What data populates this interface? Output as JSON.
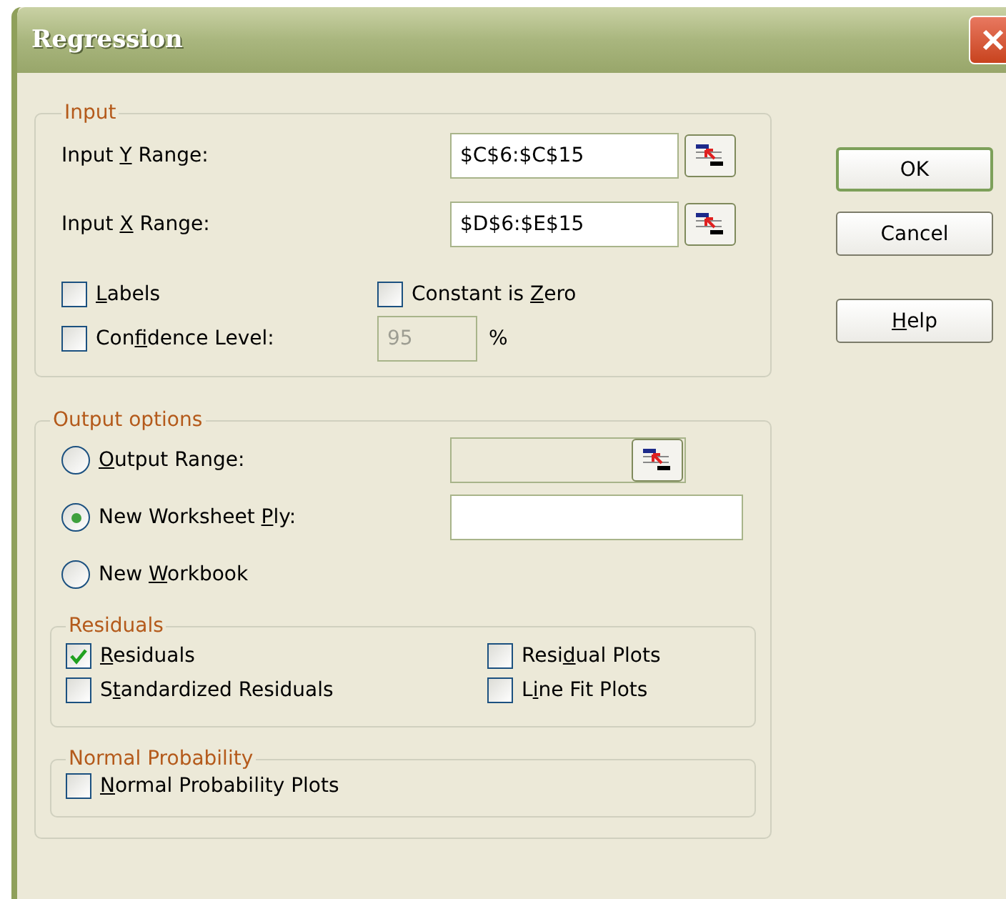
{
  "window": {
    "title": "Regression"
  },
  "input": {
    "title": "Input",
    "ranges": [
      {
        "label": {
          "pre": "Input ",
          "key": "Y",
          "post": " Range:"
        },
        "value": "$C$6:$C$15",
        "disabled": false
      },
      {
        "label": {
          "pre": "Input ",
          "key": "X",
          "post": " Range:"
        },
        "value": "$D$6:$E$15",
        "disabled": false
      }
    ],
    "labels": {
      "label": {
        "key": "L",
        "post": "abels"
      },
      "checked": false
    },
    "constant_zero": {
      "label": {
        "pre": "Constant is ",
        "key": "Z",
        "post": "ero"
      },
      "checked": false
    },
    "confidence": {
      "label": {
        "pre": "Con",
        "key": "f",
        "post": "idence Level:"
      },
      "checked": false,
      "value": "95",
      "disabled": true,
      "unit": "%"
    }
  },
  "output": {
    "title": "Output options",
    "destinations": [
      {
        "label": {
          "key": "O",
          "post": "utput Range:"
        },
        "selected": false,
        "field": {
          "disabled": true,
          "picker": true
        }
      },
      {
        "label": {
          "pre": "New Worksheet ",
          "key": "P",
          "post": "ly:"
        },
        "selected": true,
        "field": {
          "disabled": false,
          "picker": false
        }
      },
      {
        "label": {
          "pre": "New ",
          "key": "W",
          "post": "orkbook"
        },
        "selected": false
      }
    ],
    "residuals": {
      "title": "Residuals",
      "options": [
        {
          "label": {
            "key": "R",
            "post": "esiduals"
          },
          "checked": true
        },
        {
          "label": {
            "pre": "Resi",
            "key": "d",
            "post": "ual Plots"
          },
          "checked": false
        },
        {
          "label": {
            "pre": "S",
            "key": "t",
            "post": "andardized Residuals"
          },
          "checked": false
        },
        {
          "label": {
            "pre": "L",
            "key": "i",
            "post": "ne Fit Plots"
          },
          "checked": false
        }
      ]
    },
    "normal_probability": {
      "title": "Normal Probability",
      "options": [
        {
          "label": {
            "key": "N",
            "post": "ormal Probability Plots"
          },
          "checked": false
        }
      ]
    }
  },
  "buttons": [
    {
      "label": {
        "pre": "OK"
      },
      "default": true
    },
    {
      "label": {
        "pre": "Cancel"
      },
      "default": false
    },
    {
      "label": {
        "key": "H",
        "post": "elp"
      },
      "default": false
    }
  ]
}
